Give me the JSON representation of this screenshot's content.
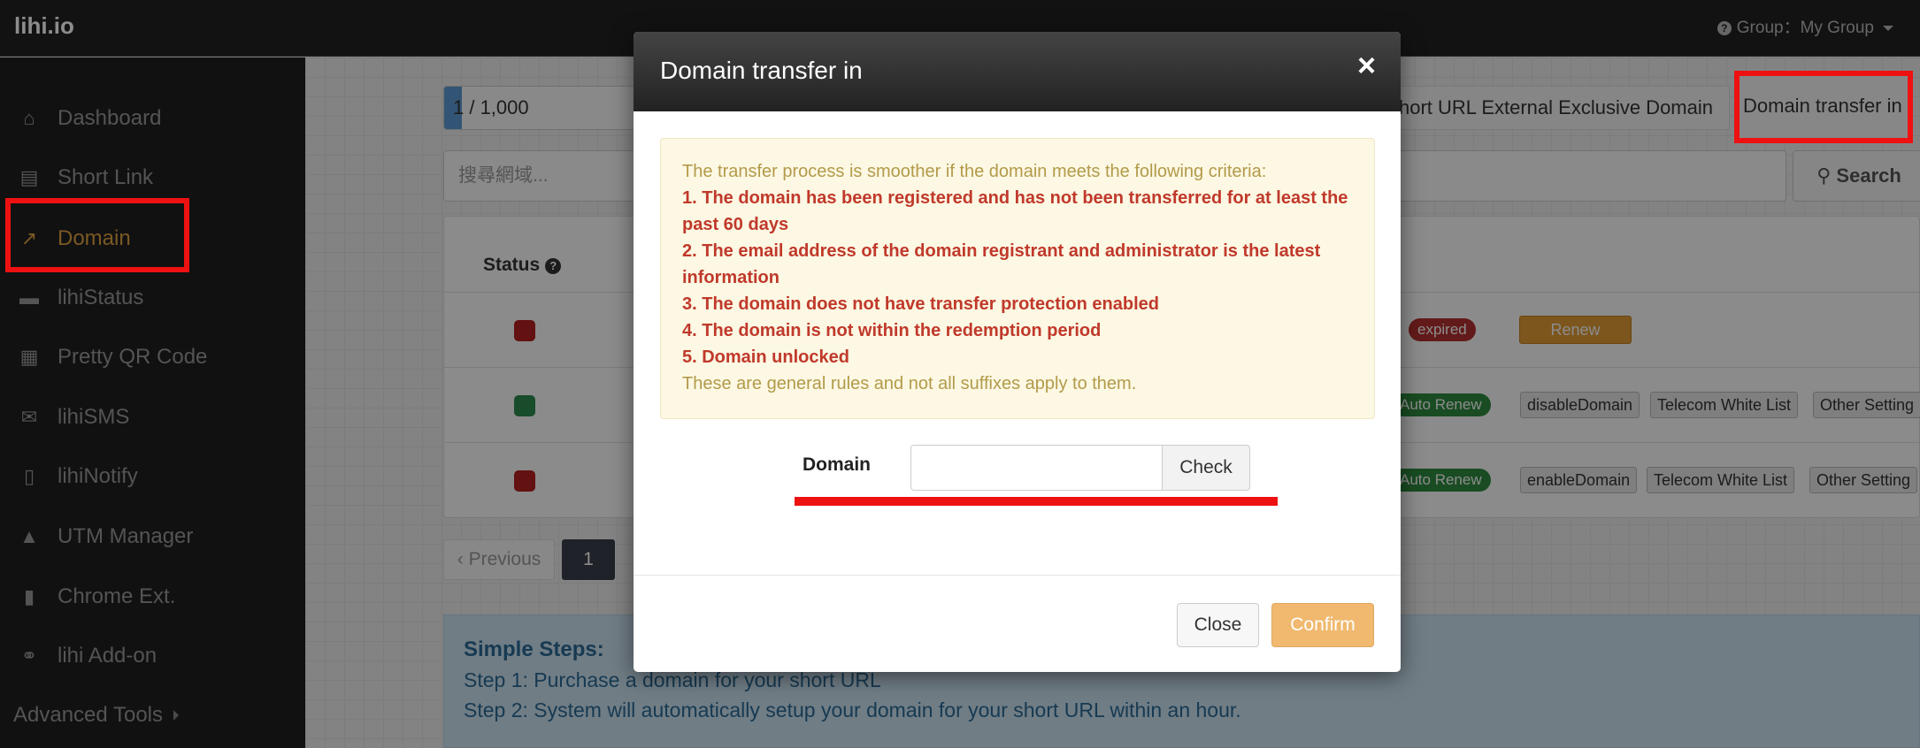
{
  "app": {
    "brand": "lihi.io",
    "group_label": "Group：My Group"
  },
  "sidebar": {
    "items": [
      {
        "label": "Dashboard",
        "icon": "home-icon"
      },
      {
        "label": "Short Link",
        "icon": "list-icon"
      },
      {
        "label": "Domain",
        "icon": "external-link-icon",
        "active": true
      },
      {
        "label": "lihiStatus",
        "icon": "card-icon"
      },
      {
        "label": "Pretty QR Code",
        "icon": "qr-icon"
      },
      {
        "label": "lihiSMS",
        "icon": "envelope-icon"
      },
      {
        "label": "lihiNotify",
        "icon": "mobile-icon"
      },
      {
        "label": "UTM Manager",
        "icon": "road-icon"
      },
      {
        "label": "Chrome Ext.",
        "icon": "bookmark-icon"
      },
      {
        "label": "lihi Add-on",
        "icon": "link-icon"
      }
    ],
    "advanced": "Advanced Tools"
  },
  "main": {
    "quota": "1 / 1,000",
    "tab_external": "hort URL External Exclusive Domain",
    "tab_transfer": "Domain transfer in",
    "search_placeholder": "搜尋網域...",
    "search_button": "Search",
    "table": {
      "status_header": "Status",
      "rows": [
        {
          "status": "red",
          "badge": "expired",
          "actions": [
            "Renew"
          ]
        },
        {
          "status": "green",
          "badge": "Auto Renew",
          "actions": [
            "disableDomain",
            "Telecom White List",
            "Other Setting"
          ]
        },
        {
          "status": "red",
          "badge": "Auto Renew",
          "actions": [
            "enableDomain",
            "Telecom White List",
            "Other Setting"
          ]
        }
      ]
    },
    "pager": {
      "prev": "Previous",
      "current": "1"
    },
    "steps": {
      "title": "Simple Steps:",
      "step1": "Step 1: Purchase a domain for your short URL",
      "step2": "Step 2: System will automatically setup your domain for your short URL within an hour."
    },
    "colors": {
      "active": "#e0a240",
      "highlight": "#ee1111",
      "confirm": "#f0b96f"
    }
  },
  "modal": {
    "title": "Domain transfer in",
    "close_symbol": "×",
    "criteria_intro": "The transfer process is smoother if the domain meets the following criteria:",
    "criteria": [
      "1. The domain has been registered and has not been transferred for at least the past 60 days",
      "2. The email address of the domain registrant and administrator is the latest information",
      "3. The domain does not have transfer protection enabled",
      "4. The domain is not within the redemption period",
      "5. Domain unlocked"
    ],
    "criteria_note": "These are general rules and not all suffixes apply to them.",
    "domain_label": "Domain",
    "domain_value": "",
    "check_button": "Check",
    "close_button": "Close",
    "confirm_button": "Confirm"
  }
}
